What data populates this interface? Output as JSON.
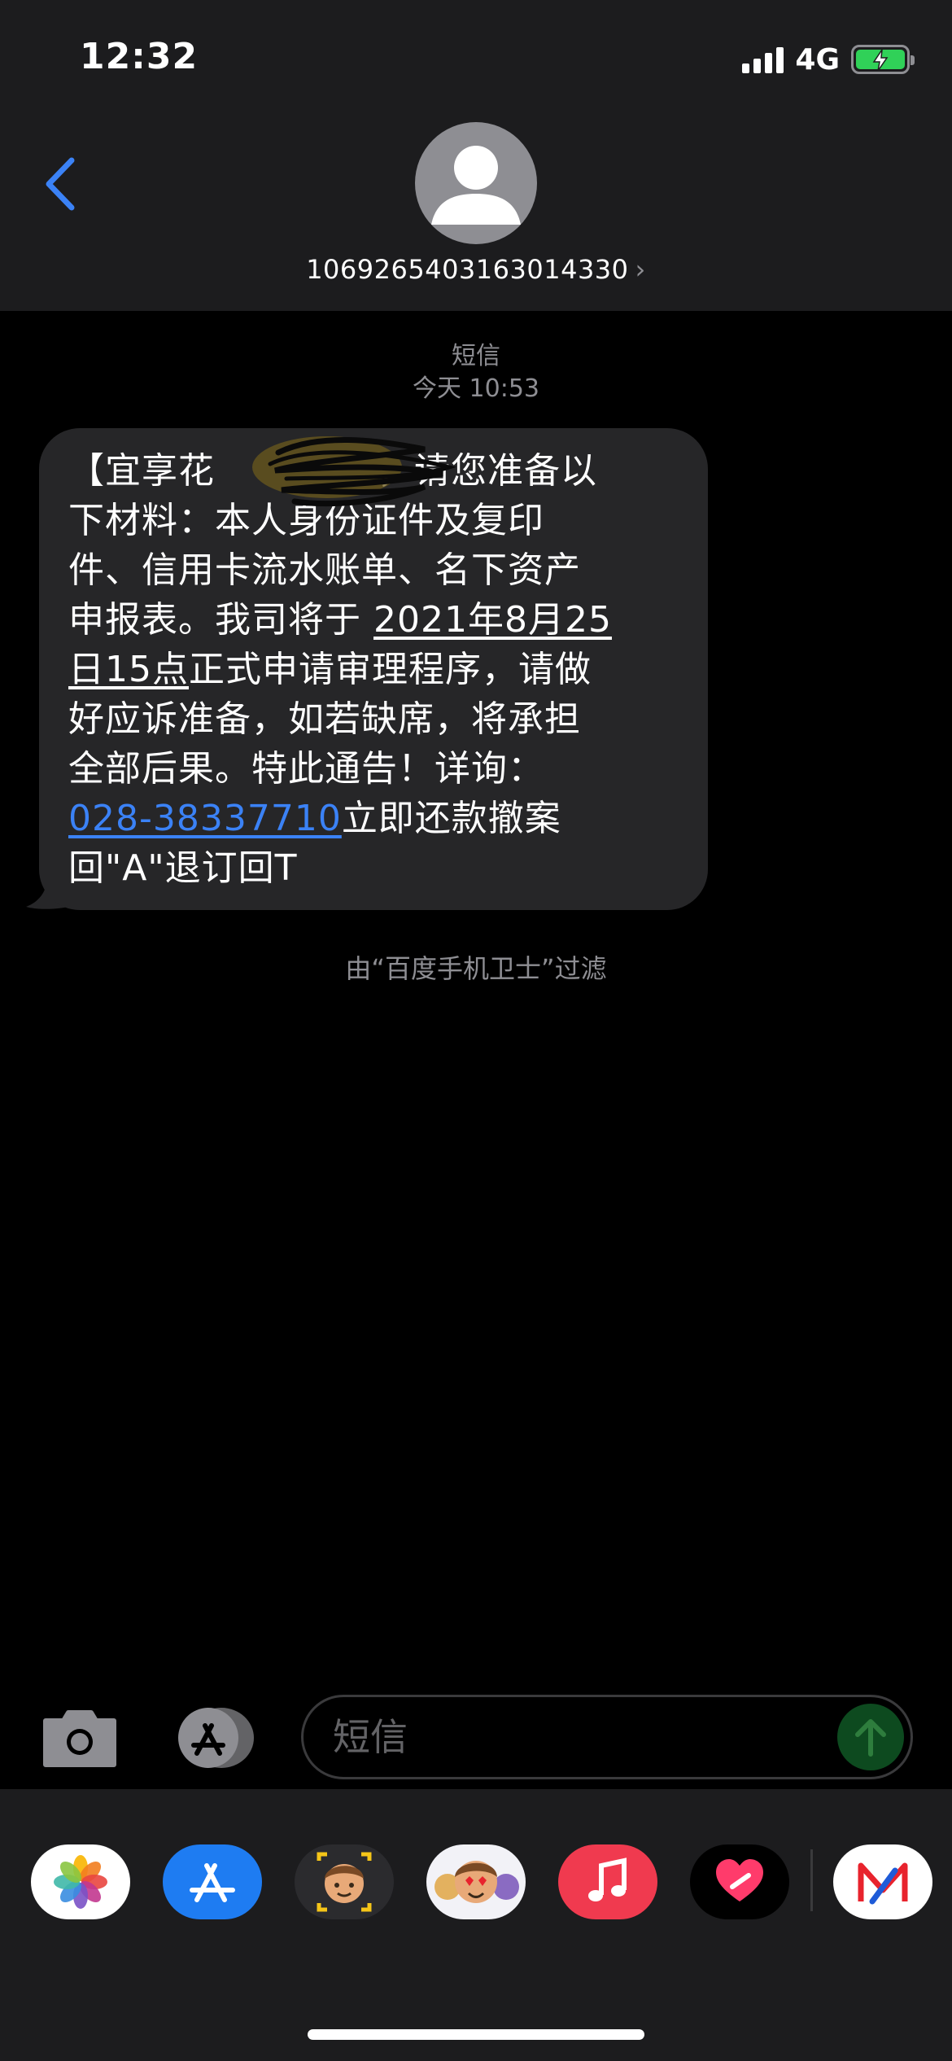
{
  "status_bar": {
    "time": "12:32",
    "network": "4G"
  },
  "header": {
    "contact": "1069265403163014330"
  },
  "conversation": {
    "service": "短信",
    "timestamp": "今天 10:53",
    "message": {
      "p1": "【宜享花",
      "p2": "，请您准备以\n下材料：本人身份证件及复印\n件、信用卡流水账单、名下资产\n申报表。我司将于 ",
      "date": "2021年8月25\n日15点",
      "p3": "正式申请审理程序，请做\n好应诉准备，如若缺席，将承担\n全部后果。特此通告！详询：\n",
      "phone": "028-38337710",
      "p4": "立即还款撤案\n回\"A\"退订回T"
    },
    "filter_note": "由“百度手机卫士”过滤"
  },
  "composer": {
    "placeholder": "短信"
  },
  "colors": {
    "accent": "#3b82f6",
    "battery": "#30d158",
    "bubble": "#262628"
  }
}
